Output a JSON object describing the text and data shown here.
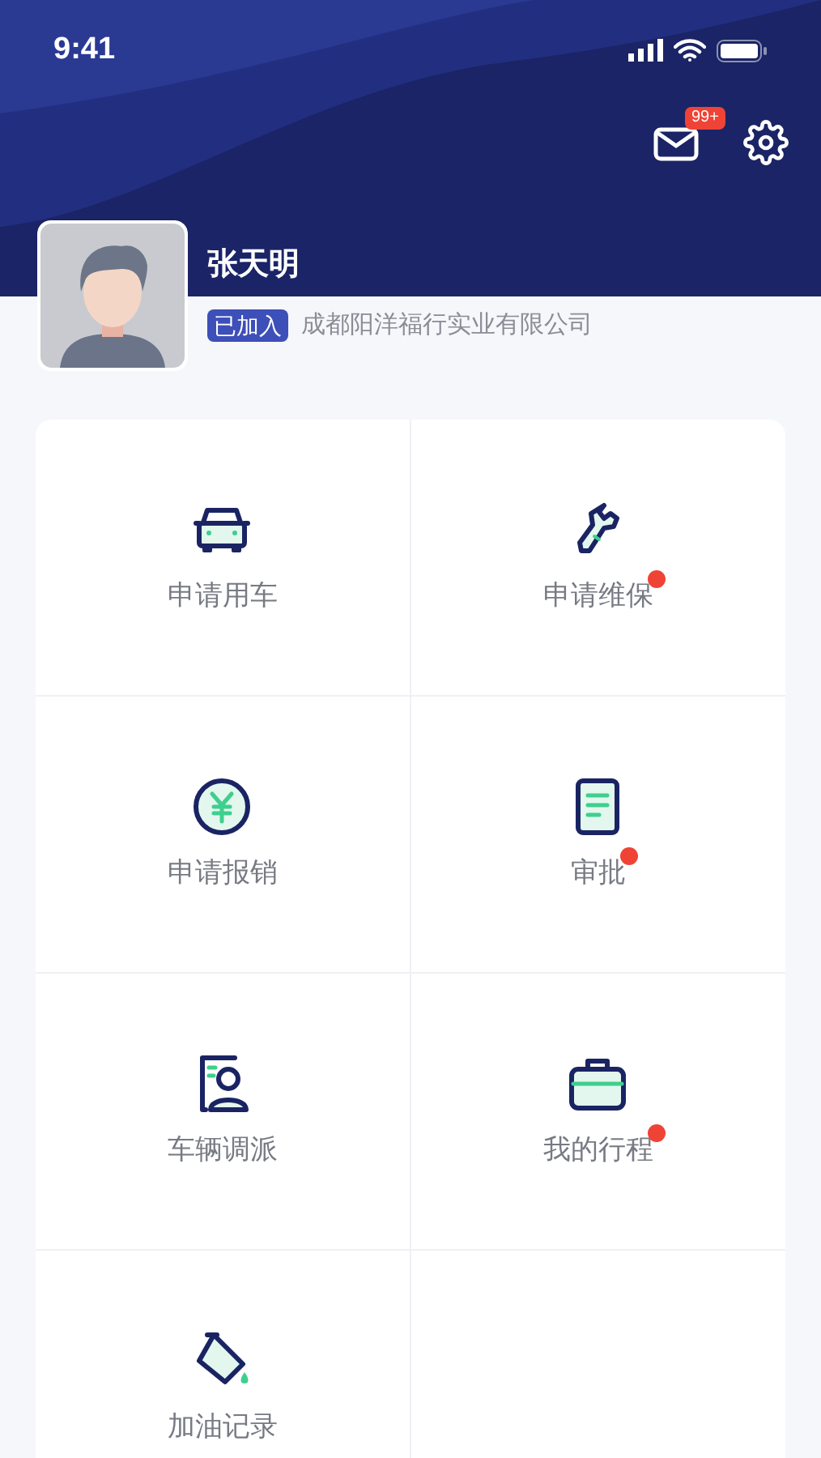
{
  "status_bar": {
    "time": "9:41"
  },
  "header": {
    "message_badge": "99+"
  },
  "profile": {
    "name": "张天明",
    "status_tag": "已加入",
    "company": "成都阳洋福行实业有限公司"
  },
  "menu": [
    {
      "label": "申请用车",
      "badge": false
    },
    {
      "label": "申请维保",
      "badge": true
    },
    {
      "label": "申请报销",
      "badge": false
    },
    {
      "label": "审批",
      "badge": true
    },
    {
      "label": "车辆调派",
      "badge": false
    },
    {
      "label": "我的行程",
      "badge": true
    },
    {
      "label": "加油记录",
      "badge": false
    }
  ]
}
